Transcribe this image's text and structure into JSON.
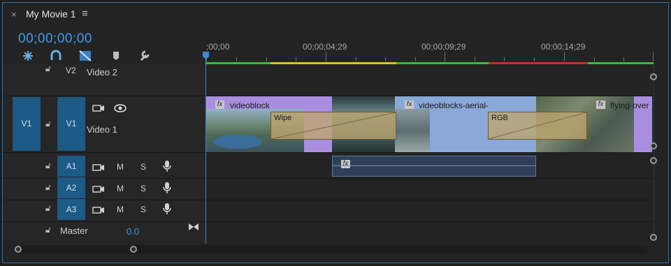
{
  "tab": {
    "close": "×",
    "title": "My Movie 1",
    "menu_icon": "hamburger-icon"
  },
  "timecode": "00;00;00;00",
  "tools": [
    "snap-icon",
    "linked-selection-icon",
    "insert-overwrite-icon",
    "add-marker-icon",
    "wrench-icon"
  ],
  "ruler": {
    "labels": [
      ";00;00",
      "00;00;04;29",
      "00;00;09;29",
      "00;00;14;29"
    ]
  },
  "tracks": {
    "v2": {
      "id": "V2",
      "name": "Video 2"
    },
    "v1": {
      "source": "V1",
      "id": "V1",
      "name": "Video 1"
    },
    "audio": [
      {
        "id": "A1",
        "m": "M",
        "s": "S"
      },
      {
        "id": "A2",
        "m": "M",
        "s": "S"
      },
      {
        "id": "A3",
        "m": "M",
        "s": "S"
      }
    ],
    "master": {
      "name": "Master",
      "value": "0.0"
    }
  },
  "clips": {
    "c1": "videoblock",
    "c2": "videoblocks-aerial-",
    "c3": "flying-over",
    "fx": "fx"
  },
  "transitions": {
    "t1": "Wipe",
    "t2": "RGB"
  },
  "colors": {
    "accent": "#3d9bea",
    "render_green": "#2ec52e",
    "render_yellow": "#e0c020",
    "render_red": "#d02a2a",
    "clip_violet": "#a98ee0",
    "clip_blue": "#8aa8d8"
  }
}
